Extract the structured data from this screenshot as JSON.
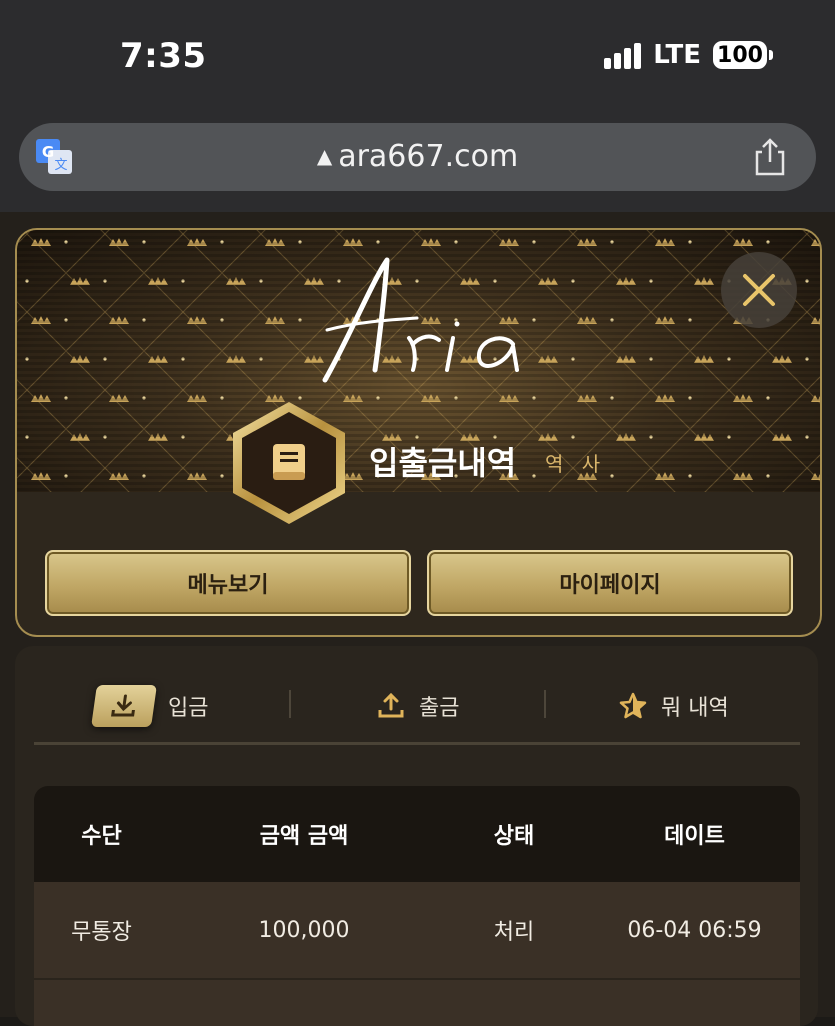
{
  "status_bar": {
    "time": "7:35",
    "network": "LTE",
    "battery": "100"
  },
  "browser": {
    "url": "ara667.com"
  },
  "modal": {
    "logo_text": "Aria",
    "title": "입출금내역",
    "subtitle": "역 사",
    "buttons": {
      "menu": "메뉴보기",
      "mypage": "마이페이지"
    }
  },
  "tabs": {
    "deposit": "입금",
    "withdraw": "출금",
    "history": "뭐 내역"
  },
  "table": {
    "headers": [
      "수단",
      "금액 금액",
      "상태",
      "데이트"
    ],
    "rows": [
      {
        "method": "무통장",
        "amount": "100,000",
        "status": "처리",
        "date": "06-04 06:59"
      }
    ]
  },
  "colors": {
    "gold": "#c0a765",
    "gold_light": "#e6d59e",
    "modal_bg": "#2e271d",
    "panel_bg": "#2a251e"
  }
}
